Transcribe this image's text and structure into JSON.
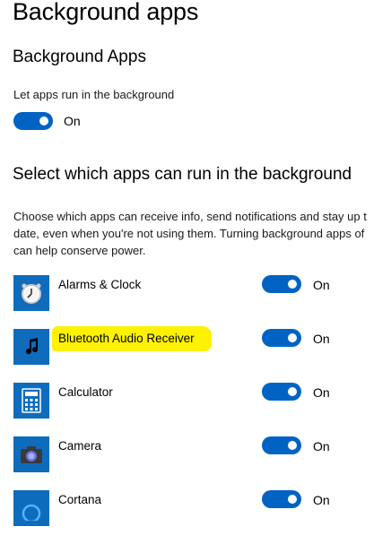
{
  "page": {
    "title": "Background apps"
  },
  "background_apps": {
    "section_title": "Background Apps",
    "toggle_caption": "Let apps run in the background",
    "toggle_state": "On"
  },
  "select_apps": {
    "section_title": "Select which apps can run in the background",
    "description_lines": [
      "Choose which apps can receive info, send notifications and stay up t",
      "date, even when you're not using them. Turning background apps of",
      "can help conserve power."
    ],
    "apps": [
      {
        "name": "Alarms & Clock",
        "icon": "alarm-clock-icon",
        "state": "On"
      },
      {
        "name": "Bluetooth Audio Receiver",
        "icon": "music-note-icon",
        "state": "On",
        "highlighted": true
      },
      {
        "name": "Calculator",
        "icon": "calculator-icon",
        "state": "On"
      },
      {
        "name": "Camera",
        "icon": "camera-icon",
        "state": "On"
      },
      {
        "name": "Cortana",
        "icon": "cortana-icon",
        "state": "On"
      }
    ]
  },
  "colors": {
    "accent": "#0063c4",
    "icon_tile": "#0f6cbd",
    "highlight": "#fff200"
  }
}
